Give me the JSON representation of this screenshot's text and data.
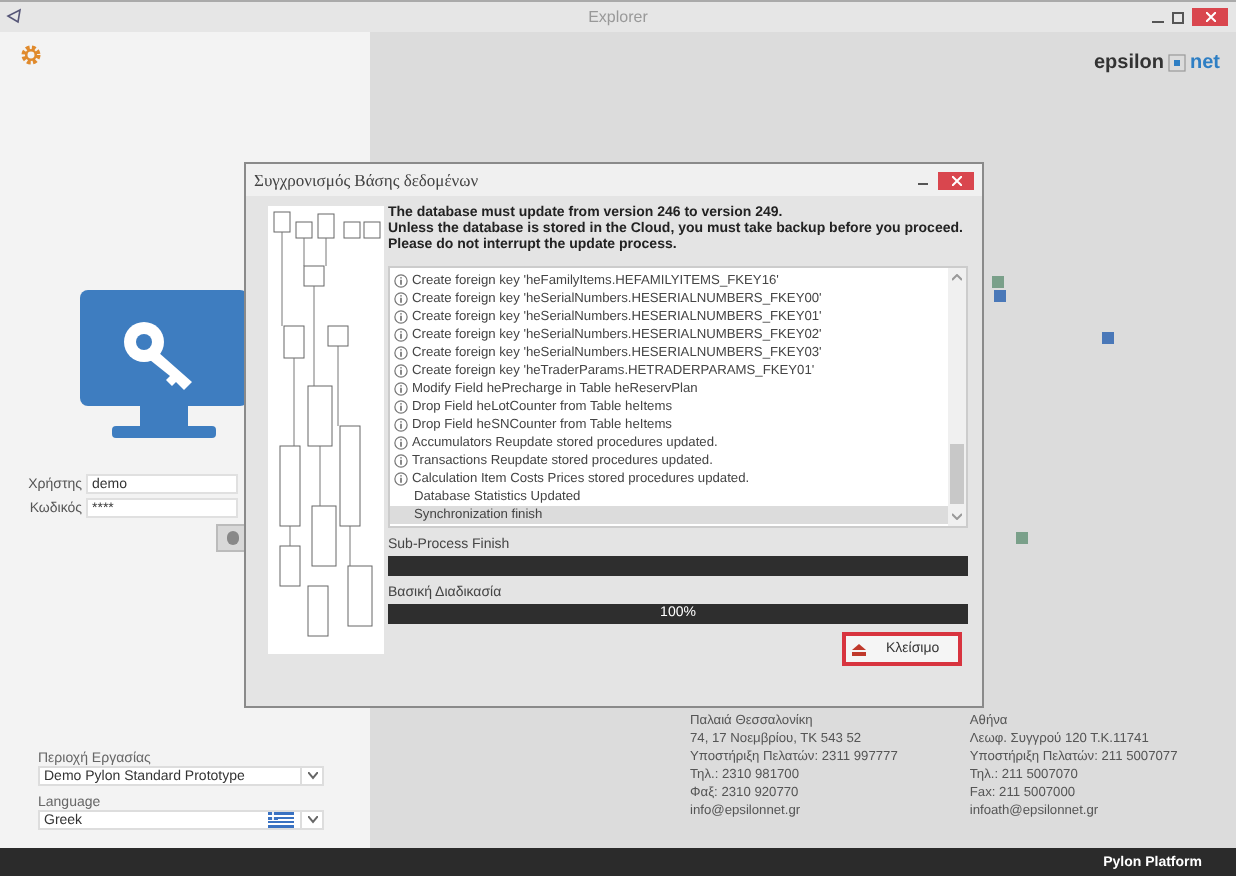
{
  "window": {
    "title": "Explorer"
  },
  "logo": {
    "left": "epsilon",
    "right": "net"
  },
  "login": {
    "fields": [
      {
        "label": "Χρήστης",
        "value": "demo"
      },
      {
        "label": "Κωδικός",
        "value": "****"
      }
    ]
  },
  "workspace": {
    "label": "Περιοχή Εργασίας",
    "value": "Demo Pylon Standard Prototype"
  },
  "language": {
    "label": "Language",
    "value": "Greek"
  },
  "addresses": [
    {
      "lines": [
        "Παλαιά Θεσσαλονίκη",
        "74, 17 Νοεμβρίου, ΤΚ 543 52",
        "Υποστήριξη Πελατών: 2311 997777",
        "Τηλ.: 2310 981700",
        "Φαξ: 2310 920770",
        "info@epsilonnet.gr"
      ]
    },
    {
      "lines": [
        "Αθήνα",
        "Λεωφ. Συγγρού 120 Τ.Κ.11741",
        "Υποστήριξη Πελατών: 211 5007077",
        "Τηλ.: 211 5007070",
        "Fax: 211 5007000",
        "infoath@epsilonnet.gr"
      ]
    }
  ],
  "status_bar": {
    "text": "Pylon Platform"
  },
  "dialog": {
    "title": "Συγχρονισμός Βάσης δεδομένων",
    "message": [
      "The database must update from version 246 to version 249.",
      "Unless the database is stored in the Cloud, you must take backup before you proceed.",
      "Please do not interrupt the update process."
    ],
    "log": [
      {
        "kind": "info",
        "text": "Create foreign key 'heFamilyItems.HEFAMILYITEMS_FKEY16'",
        "selected": false
      },
      {
        "kind": "info",
        "text": "Create foreign key 'heSerialNumbers.HESERIALNUMBERS_FKEY00'",
        "selected": false
      },
      {
        "kind": "info",
        "text": "Create foreign key 'heSerialNumbers.HESERIALNUMBERS_FKEY01'",
        "selected": false
      },
      {
        "kind": "info",
        "text": "Create foreign key 'heSerialNumbers.HESERIALNUMBERS_FKEY02'",
        "selected": false
      },
      {
        "kind": "info",
        "text": "Create foreign key 'heSerialNumbers.HESERIALNUMBERS_FKEY03'",
        "selected": false
      },
      {
        "kind": "info",
        "text": "Create foreign key 'heTraderParams.HETRADERPARAMS_FKEY01'",
        "selected": false
      },
      {
        "kind": "info",
        "text": "Modify Field hePrecharge in Table heReservPlan",
        "selected": false
      },
      {
        "kind": "info",
        "text": "Drop Field heLotCounter from Table heItems",
        "selected": false
      },
      {
        "kind": "info",
        "text": "Drop Field heSNCounter from Table heItems",
        "selected": false
      },
      {
        "kind": "info",
        "text": "Accumulators Reupdate stored procedures updated.",
        "selected": false
      },
      {
        "kind": "info",
        "text": "Transactions Reupdate stored procedures updated.",
        "selected": false
      },
      {
        "kind": "info",
        "text": "Calculation Item Costs Prices stored procedures updated.",
        "selected": false
      },
      {
        "kind": "plain",
        "text": "Database Statistics Updated",
        "selected": false
      },
      {
        "kind": "plain",
        "text": "Synchronization finish",
        "selected": true
      }
    ],
    "progress": [
      {
        "label": "Sub-Process Finish",
        "level": 1
      },
      {
        "label": "Βασική Διαδικασία",
        "level": 1,
        "reading": "100%"
      }
    ],
    "close_button": {
      "label": "Κλείσιμο"
    }
  }
}
